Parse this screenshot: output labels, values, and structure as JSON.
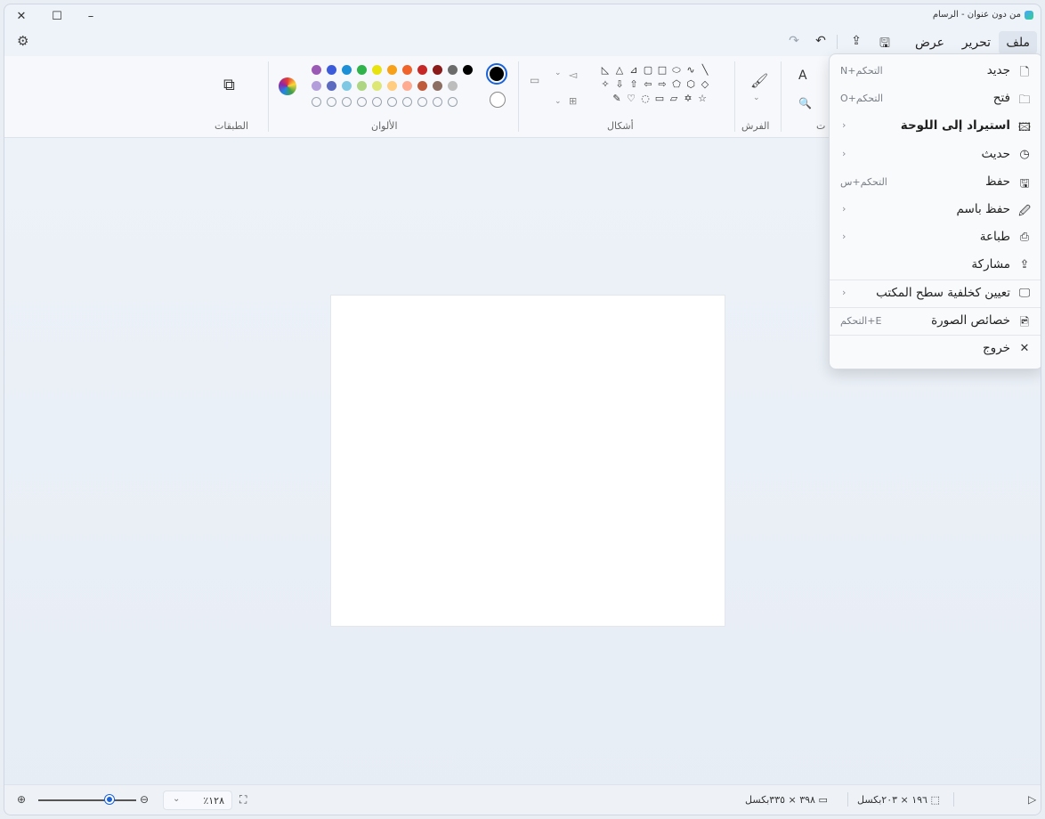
{
  "window": {
    "title": "من دون عنوان - الرسام",
    "controls": {
      "close": "✕",
      "maximize": "☐",
      "minimize": "–"
    }
  },
  "menubar": {
    "file": "ملف",
    "edit": "تحرير",
    "view": "عرض",
    "icons": [
      "save-icon",
      "share-icon",
      "undo-icon",
      "redo-icon",
      "settings-icon"
    ]
  },
  "ribbon": {
    "groups": {
      "layers": "الطبقات",
      "colors": "الألوان",
      "shapes": "أشكال",
      "brushes": "الفرش",
      "tools": "ت"
    },
    "text_tool": "A",
    "colors_row1": [
      "#9b59b6",
      "#3b5bdb",
      "#1c8fd6",
      "#2fb34a",
      "#e8e30f",
      "#f7a11a",
      "#f0632b",
      "#c62828",
      "#8b1a1a",
      "#6b6b6b",
      "#000000"
    ],
    "colors_row2": [
      "#b39ddb",
      "#5c6bc0",
      "#7ec8e3",
      "#aed581",
      "#dce775",
      "#ffcc80",
      "#ffab91",
      "#bf5b3a",
      "#8d6e63",
      "#bdbdbd"
    ],
    "primary_color": "#000000",
    "secondary_color": "#ffffff",
    "shapes_row1": [
      "◺",
      "△",
      "⊿",
      "▢",
      "□",
      "⬭",
      "∿",
      "╲"
    ],
    "shapes_row2": [
      "✧",
      "⇩",
      "⇧",
      "⇦",
      "⇨",
      "⬠",
      "⬡",
      "◇"
    ],
    "shapes_row3": [
      "✎",
      "♡",
      "◌",
      "▭",
      "▱",
      "✡",
      "☆"
    ]
  },
  "file_menu": {
    "items": [
      {
        "label": "جديد",
        "shortcut": "التحكم+N",
        "icon": "new-file-icon",
        "glyph": "🗋",
        "bold": false,
        "submenu": false
      },
      {
        "label": "فتح",
        "shortcut": "التحكم+O",
        "icon": "open-folder-icon",
        "glyph": "🗀",
        "bold": false,
        "submenu": false
      },
      {
        "label": "استيراد إلى اللوحة",
        "shortcut": "",
        "icon": "import-icon",
        "glyph": "🖾",
        "bold": true,
        "submenu": true
      },
      {
        "label": "حديث",
        "shortcut": "",
        "icon": "recent-icon",
        "glyph": "◷",
        "bold": false,
        "submenu": true
      },
      {
        "label": "حفظ",
        "shortcut": "التحكم+س",
        "icon": "save-icon",
        "glyph": "🖫",
        "bold": false,
        "submenu": false
      },
      {
        "label": "حفظ باسم",
        "shortcut": "",
        "icon": "save-as-icon",
        "glyph": "🖉",
        "bold": false,
        "submenu": true
      },
      {
        "label": "طباعة",
        "shortcut": "",
        "icon": "print-icon",
        "glyph": "⎙",
        "bold": false,
        "submenu": true
      },
      {
        "label": "مشاركة",
        "shortcut": "",
        "icon": "share-icon",
        "glyph": "⇪",
        "bold": false,
        "submenu": false
      },
      {
        "label": "تعيين كخلفية سطح المكتب",
        "shortcut": "",
        "icon": "wallpaper-icon",
        "glyph": "🖵",
        "bold": false,
        "submenu": true
      },
      {
        "label": "خصائص الصورة",
        "shortcut": "E+التحكم",
        "icon": "image-properties-icon",
        "glyph": "🖻",
        "bold": false,
        "submenu": false
      },
      {
        "label": "خروج",
        "shortcut": "",
        "icon": "exit-icon",
        "glyph": "✕",
        "bold": false,
        "submenu": false
      }
    ]
  },
  "statusbar": {
    "zoom_value": "٪١٢٨",
    "selection_size": "١٩٦ × ٢٠٣بكسل",
    "canvas_size": "٣٩٨ × ٣٣٥بكسل"
  }
}
